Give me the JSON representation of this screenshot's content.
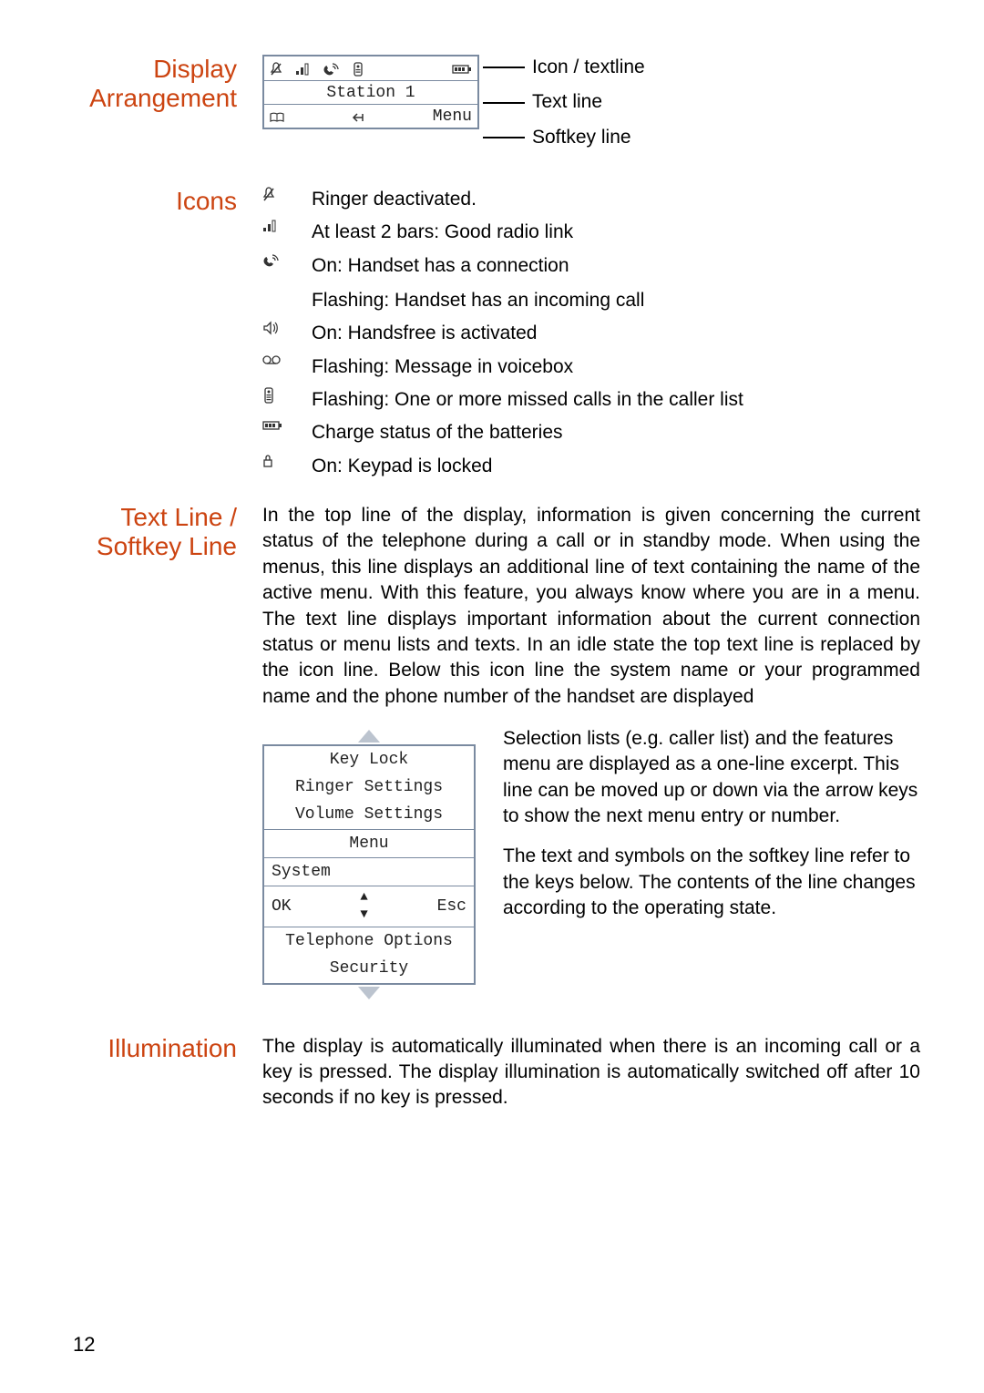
{
  "page_number": "12",
  "sections": {
    "display": {
      "heading_line1": "Display",
      "heading_line2": "Arrangement",
      "lcd_text": "Station 1",
      "lcd_softkey_right": "Menu",
      "callout_icon": "Icon / textline",
      "callout_text": "Text line",
      "callout_softkey": "Softkey line"
    },
    "icons": {
      "heading": "Icons",
      "items": [
        {
          "sym": "bell-off",
          "desc": "Ringer deactivated."
        },
        {
          "sym": "bars",
          "desc": "At least 2 bars: Good radio link"
        },
        {
          "sym": "handset",
          "desc": "On: Handset has a connection",
          "desc2": "Flashing: Handset has an incoming call"
        },
        {
          "sym": "speaker",
          "desc": "On: Handsfree is activated"
        },
        {
          "sym": "voicemail",
          "desc": "Flashing: Message in voicebox"
        },
        {
          "sym": "missed",
          "desc": "Flashing: One or more missed calls in the caller list"
        },
        {
          "sym": "battery",
          "desc": "Charge status of the batteries"
        },
        {
          "sym": "lock",
          "desc": "On: Keypad is locked"
        }
      ]
    },
    "textline": {
      "heading": "Text Line / Softkey Line",
      "para": "In the top line of the display, information is given concerning the current status of the telephone during a call or in standby mode. When using the menus, this line displays an additional line of text containing the name of the active menu. With this feature, you always know where you are in a menu. The text line displays important information about the current connection status or menu lists and texts. In an idle state the top text line is replaced by the icon line. Below this icon line the system name or your programmed name and the phone number of the handset are displayed",
      "menu": {
        "l1": "Key Lock",
        "l2": "Ringer Settings",
        "l3": "Volume Settings",
        "l4": "Menu",
        "l5": "System",
        "ok": "OK",
        "esc": "Esc",
        "l6": "Telephone Options",
        "l7": "Security"
      },
      "side_p1": "Selection lists (e.g. caller list) and the features menu are displayed as a one-line excerpt. This line can be moved up or down via the arrow keys to show the next menu entry or number.",
      "side_p2": "The text and symbols on the softkey line refer to the keys below. The contents of the line changes according to the operating state."
    },
    "illum": {
      "heading": "Illumination",
      "para": "The display is automatically illuminated when there is an incoming call or a key is pressed. The display illumination is automatically switched off after 10 seconds if no key is pressed."
    }
  }
}
